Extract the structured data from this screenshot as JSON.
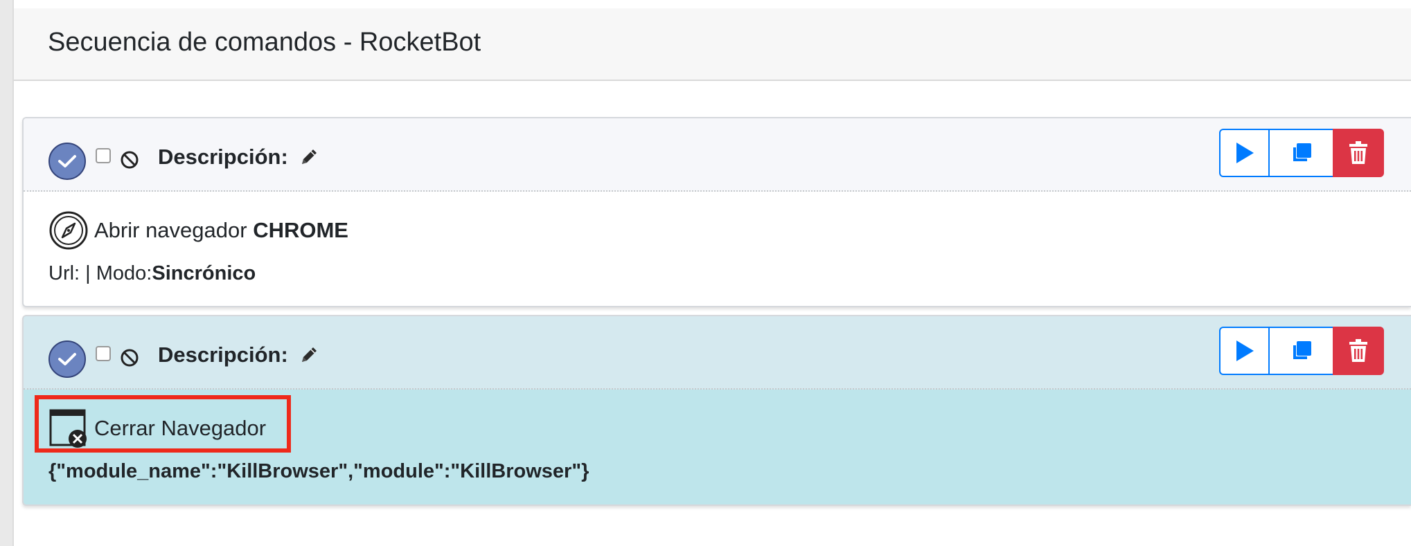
{
  "panel": {
    "title": "Secuencia de comandos - RocketBot"
  },
  "commands": [
    {
      "description_label": "Descripción:",
      "command_prefix": "Abrir navegador ",
      "command_emphasis": "CHROME",
      "meta_prefix": "Url: | Modo:",
      "meta_value": "Sincrónico",
      "icon": "compass-icon"
    },
    {
      "description_label": "Descripción:",
      "command_prefix": "Cerrar Navegador",
      "meta_value": "{\"module_name\":\"KillBrowser\",\"module\":\"KillBrowser\"}",
      "icon": "close-window-icon",
      "highlighted": true
    }
  ],
  "colors": {
    "primary": "#007bff",
    "danger": "#dc3545",
    "info_bg": "#bee5eb",
    "check_circle": "#6b84c0",
    "highlight": "#ee2a1b"
  },
  "icons": {
    "run": "play-icon",
    "copy": "copy-icon",
    "delete": "trash-icon",
    "edit": "pencil-icon",
    "disable": "ban-icon",
    "active": "check-icon"
  }
}
